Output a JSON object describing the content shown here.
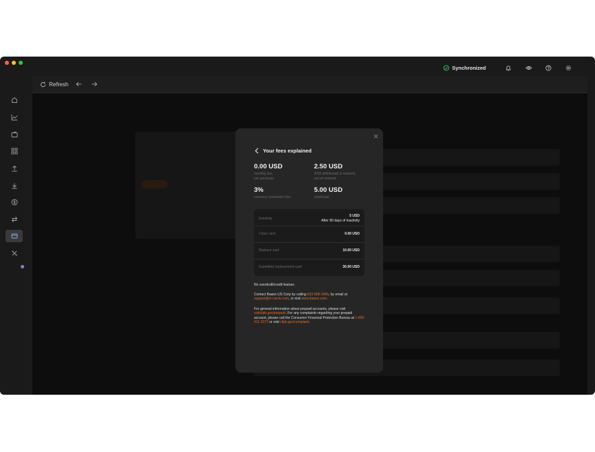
{
  "window": {
    "traffic_colors": [
      "#ff5f57",
      "#febc2e",
      "#28c840"
    ]
  },
  "topbar": {
    "sync_label": "Synchronized",
    "icons": [
      "check-circle-icon",
      "bell-icon",
      "eye-icon",
      "help-icon",
      "gear-icon"
    ]
  },
  "sidebar": {
    "icons": [
      "home-icon",
      "chart-icon",
      "wallet-icon",
      "grid-icon",
      "upload-icon",
      "download-icon",
      "dollar-icon",
      "transfer-icon",
      "card-icon",
      "tools-icon"
    ],
    "active_index": 8
  },
  "toolbar": {
    "refresh_label": "Refresh"
  },
  "modal": {
    "title": "Your fees explained",
    "fees": [
      {
        "amount": "0.00 USD",
        "desc1": "monthly fee,",
        "desc2": "per purchase"
      },
      {
        "amount": "2.50 USD",
        "desc1": "ATM withdrawal in network,",
        "desc2": "out-of-network"
      },
      {
        "amount": "3%",
        "desc1": "currency conversion fee",
        "desc2": ""
      },
      {
        "amount": "5.00 USD",
        "desc1": "retail load",
        "desc2": ""
      }
    ],
    "table": [
      {
        "label": "Inactivity",
        "value": "5 USD",
        "sub": "After 90 days of inactivity"
      },
      {
        "label": "Close card",
        "value": "0.00 USD",
        "sub": ""
      },
      {
        "label": "Replace card",
        "value": "10.00 USD",
        "sub": ""
      },
      {
        "label": "Expedited replacement card",
        "value": "30.00 USD",
        "sub": ""
      }
    ],
    "note_overdraft": "No overdraft/credit feature.",
    "contact_prefix": "Contact Baanx US Corp by calling ",
    "contact_phone": "833-998-2466",
    "contact_mid": ", by email at ",
    "contact_email": "support@cl-cards.com",
    "contact_mid2": ", or visit ",
    "contact_site": "www.baanx.com",
    "contact_suffix": ".",
    "info_prefix": "For general information about prepaid accounts, please visit ",
    "info_link": "visitcfpb.gov/prepaid",
    "info_mid": ". For any complaints regarding your prepaid account, please call the Consumer Financial Protection Bureau at ",
    "info_phone": "1-855-411-2372",
    "info_mid2": " or visit ",
    "info_link2": "cfpb.gov/complaint",
    "info_suffix": "."
  },
  "colors": {
    "accent": "#e06b2a",
    "sync_green": "#4cc36a"
  }
}
